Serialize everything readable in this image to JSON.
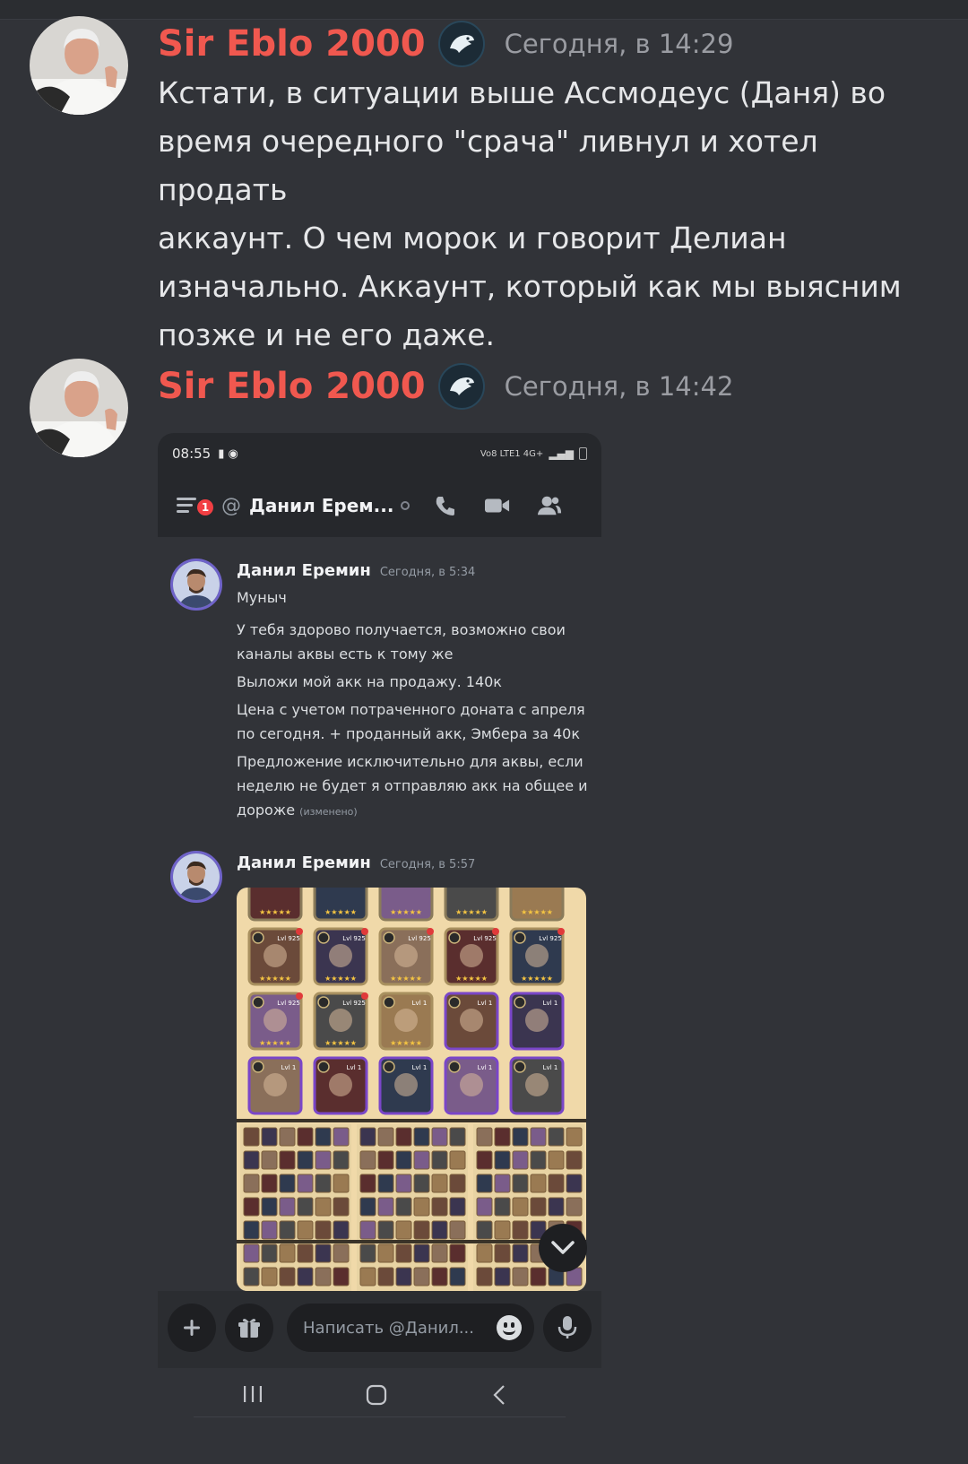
{
  "messages": [
    {
      "author": "Sir Eblo 2000",
      "timestamp": "Сегодня, в 14:29",
      "lines": [
        "Кстати, в ситуации выше Ассмодеус (Даня) во",
        "время очередного \"срача\" ливнул и хотел продать",
        "аккаунт. О чем морок и говорит Делиан",
        "изначально. Аккаунт, который как мы выясним",
        "позже и не его даже."
      ]
    },
    {
      "author": "Sir Eblo 2000",
      "timestamp": "Сегодня, в 14:42"
    }
  ],
  "screenshot": {
    "status_time": "08:55",
    "status_right": "Vo8 LTE1 4G+",
    "notification_count": "1",
    "channel_title": "Данил Ерем...",
    "messages": [
      {
        "author": "Данил Еремин",
        "timestamp": "Сегодня, в 5:34",
        "lines": [
          "Муныч",
          "У тебя здорово получается, возможно свои",
          "каналы аквы есть к тому же",
          "Выложи мой акк на продажу. 140к",
          "Цена с учетом потраченного доната с апреля",
          "по сегодня. + проданный акк, Эмбера за 40к",
          "Предложение исключительно для аквы, если",
          "неделю не будет я отправляю акк на общее и",
          "дороже"
        ],
        "edited": "(изменено)"
      },
      {
        "author": "Данил Еремин",
        "timestamp": "Сегодня, в 5:57"
      }
    ],
    "game_image": {
      "level_labels": [
        "Lvl 925",
        "Lvl 925",
        "Lvl 925",
        "Lvl 925",
        "Lvl 925",
        "Lvl 925",
        "Lvl 925",
        "Lvl 1",
        "Lvl 1",
        "Lvl 1",
        "Lvl 1",
        "Lvl 1",
        "Lvl 1",
        "Lvl 1",
        "Lvl 1"
      ]
    },
    "input_placeholder": "Написать @Данил..."
  },
  "colors": {
    "background": "#313338",
    "author": "#f0584f",
    "timestamp": "#9a9ca2",
    "notification": "#f23f43"
  },
  "icons": [
    "hamburger-icon",
    "at-icon",
    "status-dot-icon",
    "call-icon",
    "video-icon",
    "members-icon",
    "plus-icon",
    "gift-icon",
    "emoji-icon",
    "mic-icon",
    "chevron-down-icon",
    "nav-recents-icon",
    "nav-home-icon",
    "nav-back-icon",
    "bot-badge-icon"
  ]
}
